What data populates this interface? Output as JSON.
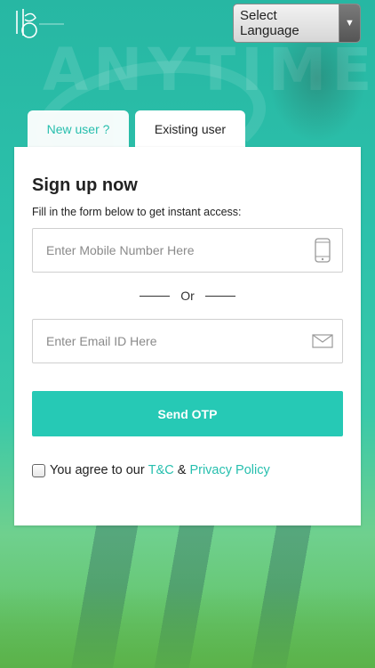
{
  "header": {
    "language_select": {
      "selected": "Select Language"
    }
  },
  "background": {
    "word": "ANYTIME"
  },
  "tabs": [
    {
      "label": "New user ?",
      "active": false
    },
    {
      "label": "Existing user",
      "active": true
    }
  ],
  "form": {
    "title": "Sign up now",
    "subtitle": "Fill in the form below to get instant access:",
    "mobile": {
      "placeholder": "Enter Mobile Number Here",
      "value": ""
    },
    "divider": "Or",
    "email": {
      "placeholder": "Enter Email ID Here",
      "value": ""
    },
    "submit_label": "Send OTP",
    "agree": {
      "prefix": "You agree to our ",
      "terms_link": "T&C",
      "joiner": " & ",
      "privacy_link": "Privacy Policy",
      "checked": false
    }
  },
  "colors": {
    "accent": "#26c9b5",
    "background": "#2bc0a8"
  },
  "icons": {
    "mobile": "mobile-phone-icon",
    "email": "envelope-icon",
    "dropdown": "triangle-down-icon"
  }
}
